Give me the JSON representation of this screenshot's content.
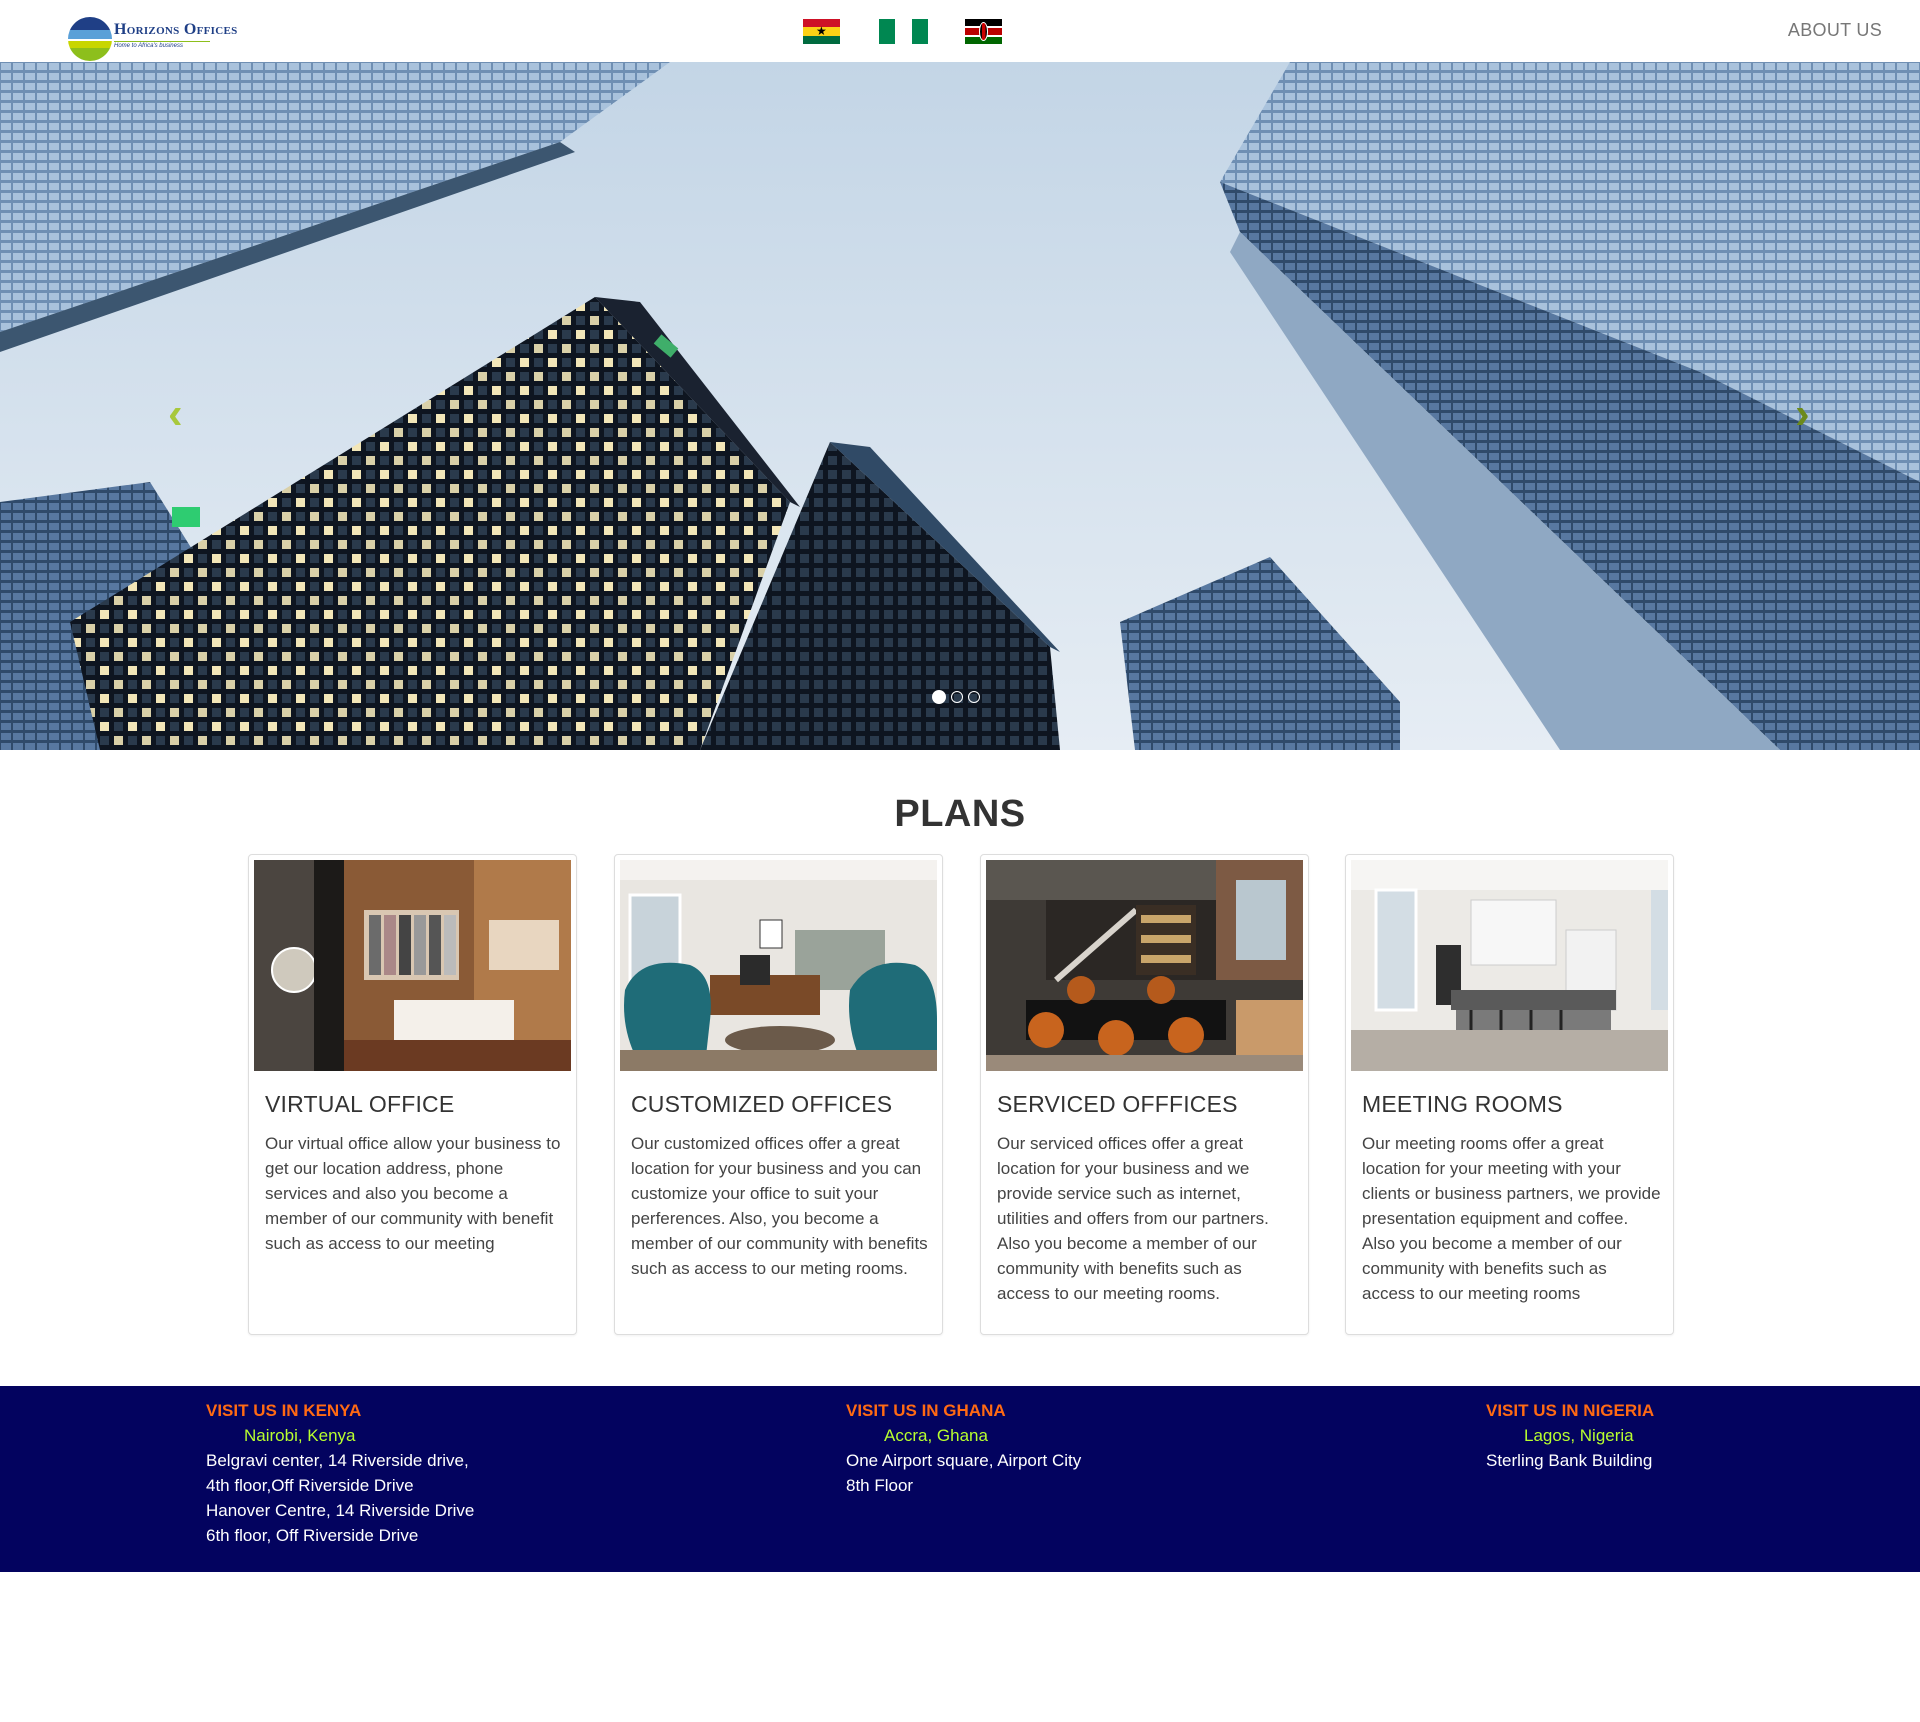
{
  "navbar": {
    "logo_title": "Horizons Offices",
    "logo_tagline": "Home to Africa's business",
    "flags": [
      "ghana-flag",
      "nigeria-flag",
      "kenya-flag"
    ],
    "about_label": "ABOUT US"
  },
  "carousel": {
    "prev_icon": "‹",
    "next_icon": "›",
    "slide_count": 3,
    "active_slide": 1
  },
  "plans": {
    "title": "PLANS",
    "cards": [
      {
        "title": "VIRTUAL OFFICE",
        "text": "Our virtual office allow your business to get our location address, phone services and also you become a member of our community with benefit such as access to our meeting",
        "image": "walk-in-closet-photo"
      },
      {
        "title": "CUSTOMIZED OFFICES",
        "text": "Our customized offices offer a great location for your business and you can customize your office to suit your perferences. Also, you become a member of our community with benefits such as access to our meting rooms.",
        "image": "office-lounge-photo"
      },
      {
        "title": "SERVICED OFFFICES",
        "text": "Our serviced offices offer a great location for your business and we provide service such as internet, utilities and offers from our partners. Also you become a member of our community with benefits such as access to our meeting rooms.",
        "image": "loft-dining-photo"
      },
      {
        "title": "MEETING ROOMS",
        "text": "Our meeting rooms offer a great location for your meeting with your clients or business partners, we provide presentation equipment and coffee. Also you become a member of our community with benefits such as access to our meeting rooms",
        "image": "kitchen-meeting-photo"
      }
    ]
  },
  "footer": {
    "kenya": {
      "heading": "VISIT US IN KENYA",
      "city": "Nairobi, Kenya",
      "lines": [
        "Belgravi center, 14 Riverside drive,",
        "4th floor,Off Riverside Drive",
        "Hanover Centre, 14 Riverside Drive",
        "6th floor, Off Riverside Drive"
      ]
    },
    "ghana": {
      "heading": "VISIT US IN GHANA",
      "city": "Accra, Ghana",
      "lines": [
        "One Airport square, Airport City",
        "8th Floor"
      ]
    },
    "nigeria": {
      "heading": "VISIT US IN NIGERIA",
      "city": "Lagos, Nigeria",
      "lines": [
        "Sterling Bank Building"
      ]
    }
  },
  "colors": {
    "footer_bg": "#03035f",
    "footer_heading": "#ff6a13",
    "footer_city": "#b8ff2f",
    "chevron": "#8dbf1c"
  }
}
